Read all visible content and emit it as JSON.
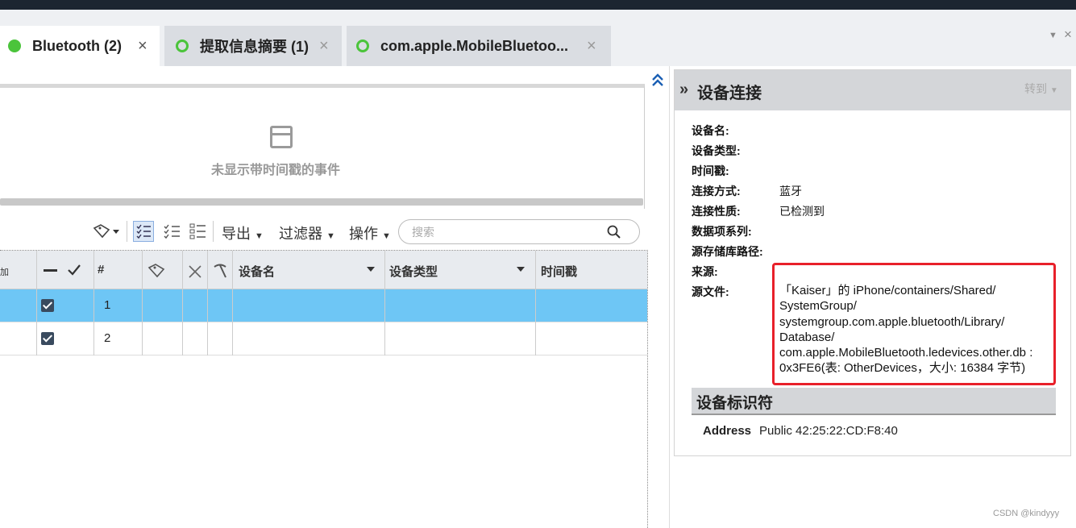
{
  "tabs": [
    {
      "label": "Bluetooth (2)",
      "state": "active",
      "close": "×"
    },
    {
      "label": "提取信息摘要 (1)",
      "state": "inactive",
      "close": "×"
    },
    {
      "label": "com.apple.MobileBluetoo...",
      "state": "inactive",
      "close": "×"
    }
  ],
  "tab_controls": {
    "menu": "▼",
    "close": "×"
  },
  "timeline": {
    "empty_message": "未显示带时间戳的事件"
  },
  "toolbar": {
    "export": "导出",
    "filter": "过滤器",
    "actions": "操作",
    "search_placeholder": "搜索"
  },
  "table": {
    "headers": {
      "partial": "加",
      "num": "#",
      "device_name": "设备名",
      "device_type": "设备类型",
      "timestamp": "时间戳"
    },
    "rows": [
      {
        "num": "1",
        "checked": true,
        "selected": true
      },
      {
        "num": "2",
        "checked": true,
        "selected": false
      }
    ]
  },
  "detail": {
    "title": "设备连接",
    "goto": "转到",
    "props": [
      {
        "key": "设备名:",
        "value": ""
      },
      {
        "key": "设备类型:",
        "value": ""
      },
      {
        "key": "时间戳:",
        "value": ""
      },
      {
        "key": "连接方式:",
        "value": "蓝牙"
      },
      {
        "key": "连接性质:",
        "value": "已检测到"
      },
      {
        "key": "数据项系列:",
        "value": ""
      },
      {
        "key": "源存储库路径:",
        "value": ""
      },
      {
        "key": "来源:",
        "value": ""
      },
      {
        "key": "源文件:",
        "value": ""
      }
    ],
    "source_file": "「Kaiser」的 iPhone/containers/Shared/\nSystemGroup/\nsystemgroup.com.apple.bluetooth/Library/\nDatabase/\ncom.apple.MobileBluetooth.ledevices.other.db :\n0x3FE6(表: OtherDevices，大小: 16384 字节)",
    "identifier_section": "设备标识符",
    "address_key": "Address",
    "address_value": "Public 42:25:22:CD:F8:40"
  },
  "watermark": "CSDN @kindyyy",
  "colors": {
    "selection": "#6ec6f5",
    "status_green": "#4bc43b",
    "highlight_red": "#e8202a",
    "checkbox": "#394a5e"
  }
}
